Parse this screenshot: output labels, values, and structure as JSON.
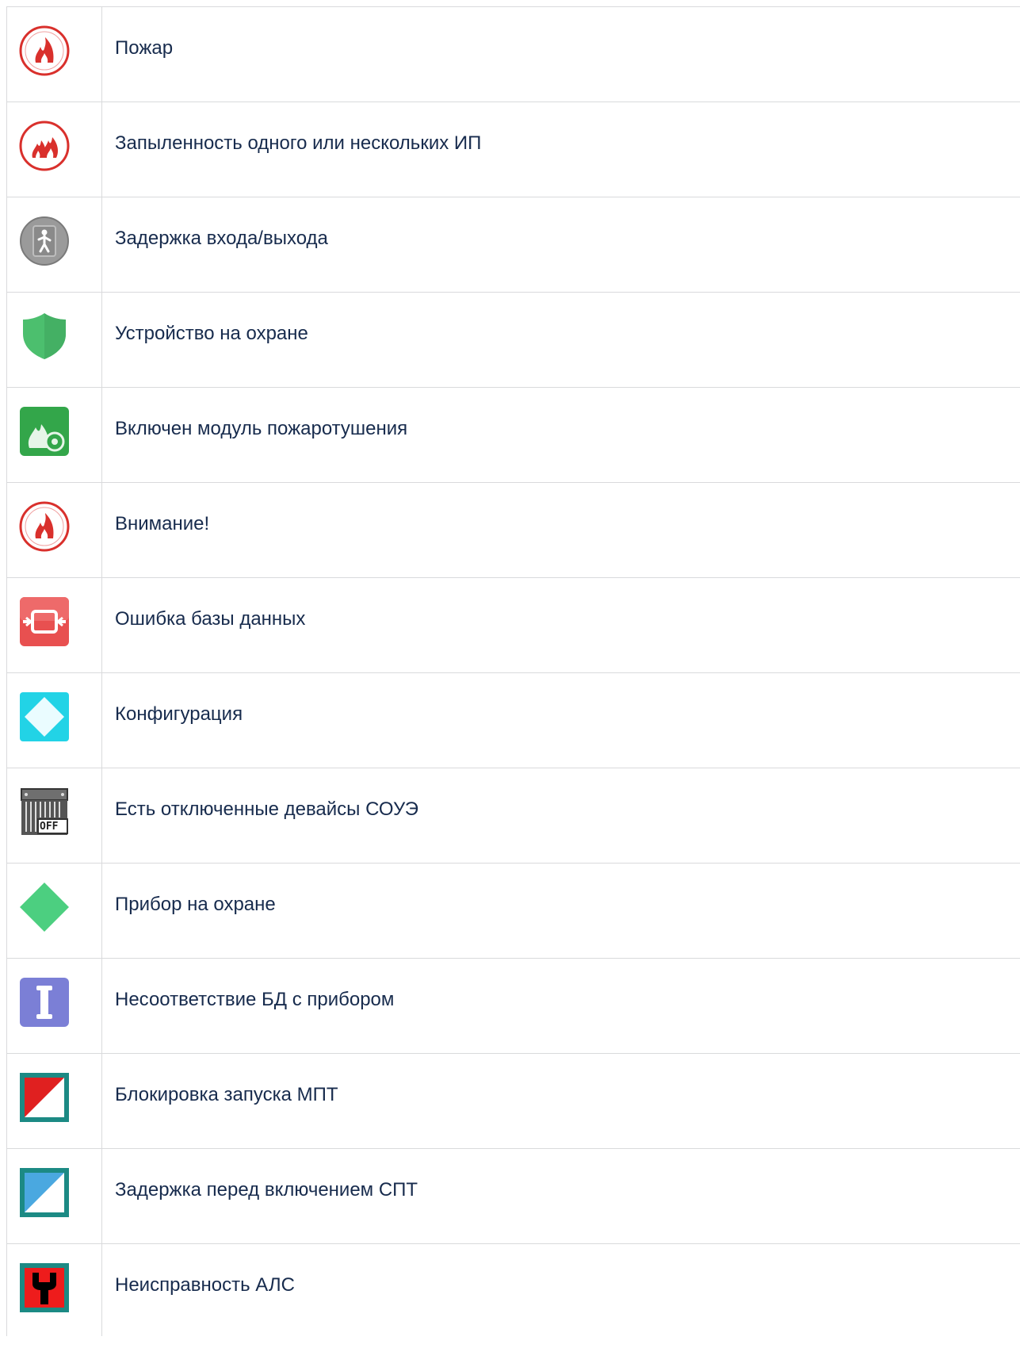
{
  "rows": [
    {
      "icon": "fire-alarm-icon",
      "label": "Пожар"
    },
    {
      "icon": "dust-fire-icon",
      "label": "Запыленность одного или нескольких ИП"
    },
    {
      "icon": "walking-person-icon",
      "label": "Задержка входа/выхода"
    },
    {
      "icon": "green-shield-icon",
      "label": "Устройство на охране"
    },
    {
      "icon": "fire-extinguish-module-icon",
      "label": "Включен модуль пожаротушения"
    },
    {
      "icon": "fire-alarm-icon",
      "label": "Внимание!"
    },
    {
      "icon": "database-error-icon",
      "label": "Ошибка базы данных"
    },
    {
      "icon": "cyan-diamond-icon",
      "label": "Конфигурация"
    },
    {
      "icon": "device-off-icon",
      "label": "Есть отключенные девайсы СОУЭ"
    },
    {
      "icon": "green-diamond-icon",
      "label": "Прибор на охране"
    },
    {
      "icon": "db-mismatch-icon",
      "label": "Несоответствие БД с прибором"
    },
    {
      "icon": "mpt-block-icon",
      "label": "Блокировка запуска МПТ"
    },
    {
      "icon": "spt-delay-icon",
      "label": "Задержка перед включением СПТ"
    },
    {
      "icon": "als-fault-icon",
      "label": "Неисправность АЛС"
    }
  ],
  "icon_off_text": "OFF",
  "colors": {
    "fire_red": "#d9302c",
    "shield_green": "#4cbf6e",
    "module_green": "#33a64a",
    "db_error_red": "#e85050",
    "cyan": "#22d3e6",
    "diamond_green": "#4ccf80",
    "mismatch_purple": "#7b7fd6",
    "teal_frame": "#1c8a84",
    "grey": "#8c8c8c",
    "border": "#d9dadc",
    "text": "#172b4d"
  }
}
